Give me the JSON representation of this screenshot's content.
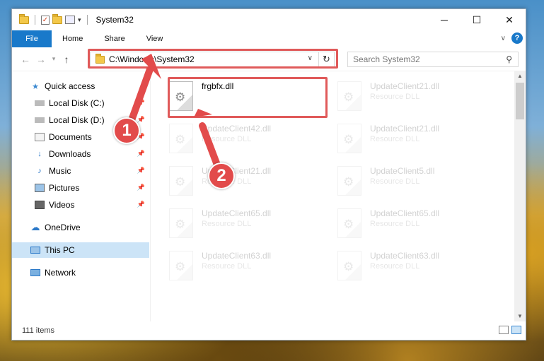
{
  "window": {
    "title": "System32"
  },
  "ribbon": {
    "tabs": [
      "File",
      "Home",
      "Share",
      "View"
    ]
  },
  "address": {
    "path": "C:\\Windows\\System32"
  },
  "search": {
    "placeholder": "Search System32"
  },
  "sidebar": {
    "items": [
      {
        "label": "Quick access",
        "icon": "star-icon"
      },
      {
        "label": "Local Disk (C:)",
        "icon": "drive-icon"
      },
      {
        "label": "Local Disk (D:)",
        "icon": "drive-icon"
      },
      {
        "label": "Documents",
        "icon": "documents-icon"
      },
      {
        "label": "Downloads",
        "icon": "download-icon"
      },
      {
        "label": "Music",
        "icon": "music-icon"
      },
      {
        "label": "Pictures",
        "icon": "pictures-icon"
      },
      {
        "label": "Videos",
        "icon": "videos-icon"
      },
      {
        "label": "OneDrive",
        "icon": "cloud-icon"
      },
      {
        "label": "This PC",
        "icon": "computer-icon"
      },
      {
        "label": "Network",
        "icon": "network-icon"
      }
    ]
  },
  "files": [
    {
      "name": "frgbfx.dll",
      "type": ""
    },
    {
      "name": "UpdateClient21.dll",
      "type": "Resource DLL"
    },
    {
      "name": "UpdateClient42.dll",
      "type": "Resource DLL"
    },
    {
      "name": "UpdateClient21.dll",
      "type": "Resource DLL"
    },
    {
      "name": "UpdateClient21.dll",
      "type": "Resource DLL"
    },
    {
      "name": "UpdateClient5.dll",
      "type": "Resource DLL"
    },
    {
      "name": "UpdateClient65.dll",
      "type": "Resource DLL"
    },
    {
      "name": "UpdateClient65.dll",
      "type": "Resource DLL"
    },
    {
      "name": "UpdateClient63.dll",
      "type": "Resource DLL"
    },
    {
      "name": "UpdateClient63.dll",
      "type": "Resource DLL"
    }
  ],
  "status": {
    "item_count": "111 items"
  },
  "annotations": {
    "step1": "1",
    "step2": "2"
  },
  "colors": {
    "accent": "#1979ca",
    "highlight": "#e05a5a",
    "selection": "#cce4f7"
  }
}
